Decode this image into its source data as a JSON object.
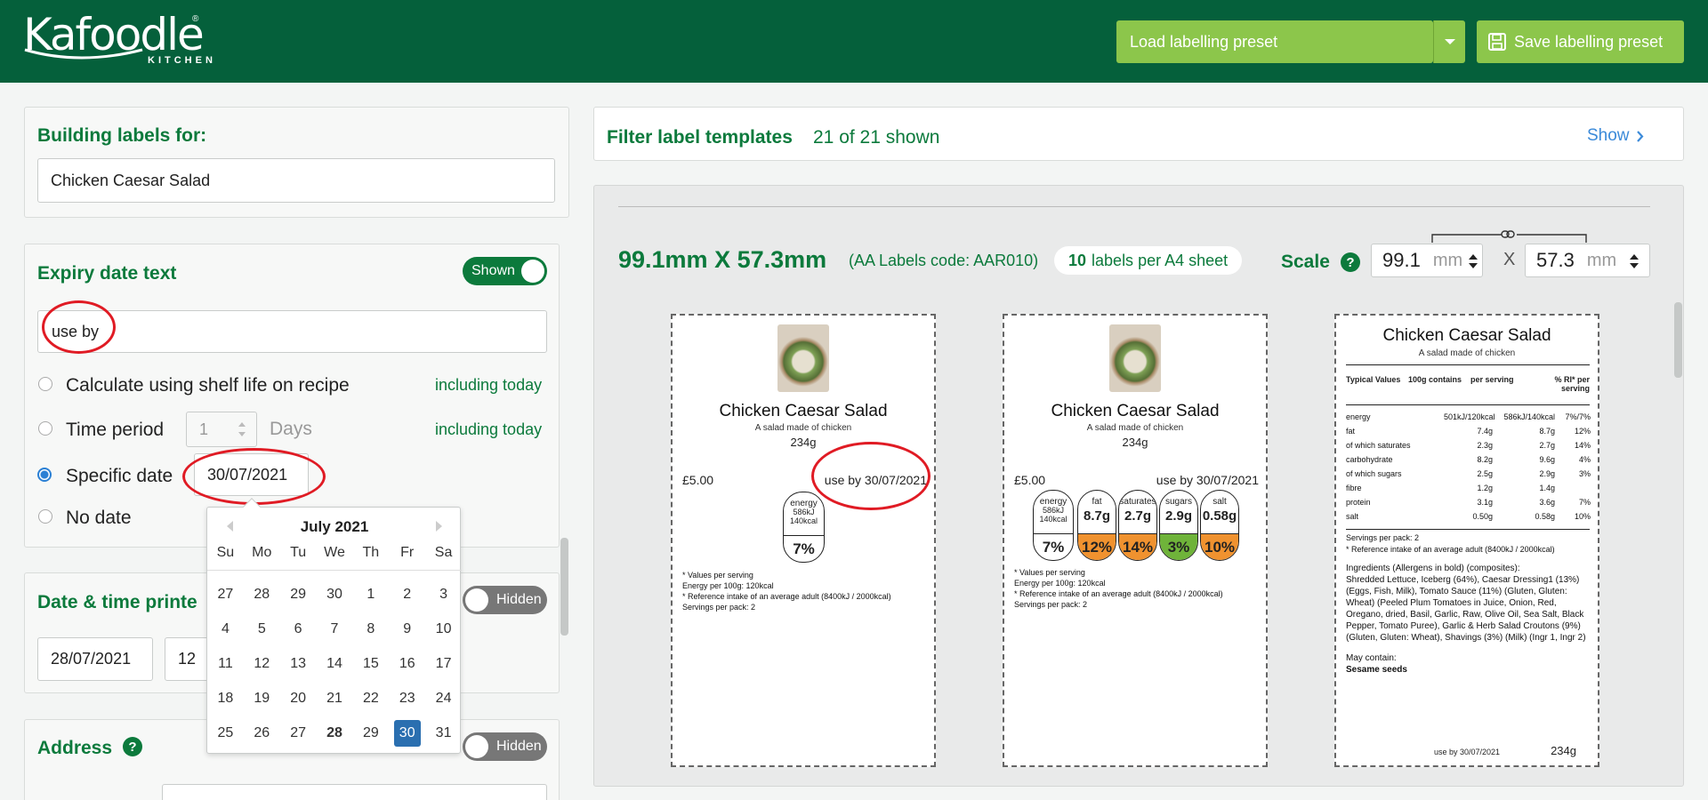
{
  "header": {
    "logo": "Kafoodle",
    "logo_sub": "KITCHEN",
    "load_preset": "Load labelling preset",
    "save_preset": "Save labelling preset"
  },
  "building": {
    "title": "Building labels for:",
    "recipe": "Chicken Caesar Salad"
  },
  "expiry": {
    "title": "Expiry date text",
    "toggle": "Shown",
    "text_value": "use by",
    "options": [
      {
        "label": "Calculate using shelf life on recipe",
        "note": "including today",
        "selected": false
      },
      {
        "label": "Time period",
        "note": "including today",
        "selected": false
      },
      {
        "label": "Specific date",
        "selected": true
      },
      {
        "label": "No date",
        "selected": false
      }
    ],
    "period_value": "1",
    "period_unit": "Days",
    "specific_date": "30/07/2021"
  },
  "calendar": {
    "month": "July 2021",
    "weekdays": [
      "Su",
      "Mo",
      "Tu",
      "We",
      "Th",
      "Fr",
      "Sa"
    ],
    "weeks": [
      [
        "27",
        "28",
        "29",
        "30",
        "1",
        "2",
        "3"
      ],
      [
        "4",
        "5",
        "6",
        "7",
        "8",
        "9",
        "10"
      ],
      [
        "11",
        "12",
        "13",
        "14",
        "15",
        "16",
        "17"
      ],
      [
        "18",
        "19",
        "20",
        "21",
        "22",
        "23",
        "24"
      ],
      [
        "25",
        "26",
        "27",
        "28",
        "29",
        "30",
        "31"
      ]
    ],
    "today": "28",
    "selected": "30"
  },
  "datetime": {
    "title": "Date & time printe",
    "toggle": "Hidden",
    "date": "28/07/2021",
    "hour": "12"
  },
  "address": {
    "title": "Address",
    "toggle": "Hidden"
  },
  "filter": {
    "title": "Filter label templates",
    "count": "21 of 21 shown",
    "show": "Show"
  },
  "template": {
    "size": "99.1mm X 57.3mm",
    "code": "(AA Labels code: AAR010)",
    "per_sheet_num": "10",
    "per_sheet_text": "labels per A4 sheet",
    "scale_label": "Scale",
    "width": "99.1",
    "height": "57.3",
    "unit": "mm",
    "x": "X"
  },
  "labels": {
    "name": "Chicken Caesar Salad",
    "desc": "A salad made of chicken",
    "weight": "234g",
    "price": "£5.00",
    "use_by": "use by 30/07/2021",
    "footnotes": [
      "* Values per serving",
      "Energy per 100g: 120kcal",
      "* Reference intake of an average adult (8400kJ / 2000kcal)",
      "Servings per pack: 2"
    ],
    "energy_pill": {
      "name": "energy",
      "kj": "586kJ",
      "kcal": "140kcal",
      "pct": "7%"
    },
    "traffic": [
      {
        "name": "fat",
        "value": "8.7g",
        "pct": "12%",
        "color": "#f0922f"
      },
      {
        "name": "saturates",
        "value": "2.7g",
        "pct": "14%",
        "color": "#f0922f"
      },
      {
        "name": "sugars",
        "value": "2.9g",
        "pct": "3%",
        "color": "#6fb33a"
      },
      {
        "name": "salt",
        "value": "0.58g",
        "pct": "10%",
        "color": "#f0922f"
      }
    ],
    "table_head": [
      "Typical Values",
      "100g contains",
      "per serving",
      "% RI* per serving"
    ],
    "table_rows": [
      [
        "energy",
        "501kJ/120kcal",
        "586kJ/140kcal",
        "7%/7%"
      ],
      [
        "fat",
        "7.4g",
        "8.7g",
        "12%"
      ],
      [
        "of which saturates",
        "2.3g",
        "2.7g",
        "14%"
      ],
      [
        "carbohydrate",
        "8.2g",
        "9.6g",
        "4%"
      ],
      [
        "of which sugars",
        "2.5g",
        "2.9g",
        "3%"
      ],
      [
        "fibre",
        "1.2g",
        "1.4g",
        ""
      ],
      [
        "protein",
        "3.1g",
        "3.6g",
        "7%"
      ],
      [
        "salt",
        "0.50g",
        "0.58g",
        "10%"
      ]
    ],
    "servings": "Servings per pack: 2",
    "ri_note": "* Reference intake of an average adult (8400kJ / 2000kcal)",
    "ingredients_title": "Ingredients (Allergens in bold) (composites):",
    "ingredients": "Shredded Lettuce, Iceberg (64%), Caesar Dressing1 (13%) (Eggs, Fish, Milk), Tomato Sauce (11%) (Gluten, Gluten: Wheat) (Peeled Plum Tomatoes in Juice, Onion, Red, Oregano, dried, Basil, Garlic, Raw, Olive Oil, Sea Salt, Black Pepper, Tomato Puree), Garlic & Herb Salad Croutons (9%) (Gluten, Gluten: Wheat), Shavings (3%) (Milk) (Ingr 1, Ingr 2)",
    "may_contain": "May contain:",
    "may_contain_value": "Sesame seeds"
  }
}
